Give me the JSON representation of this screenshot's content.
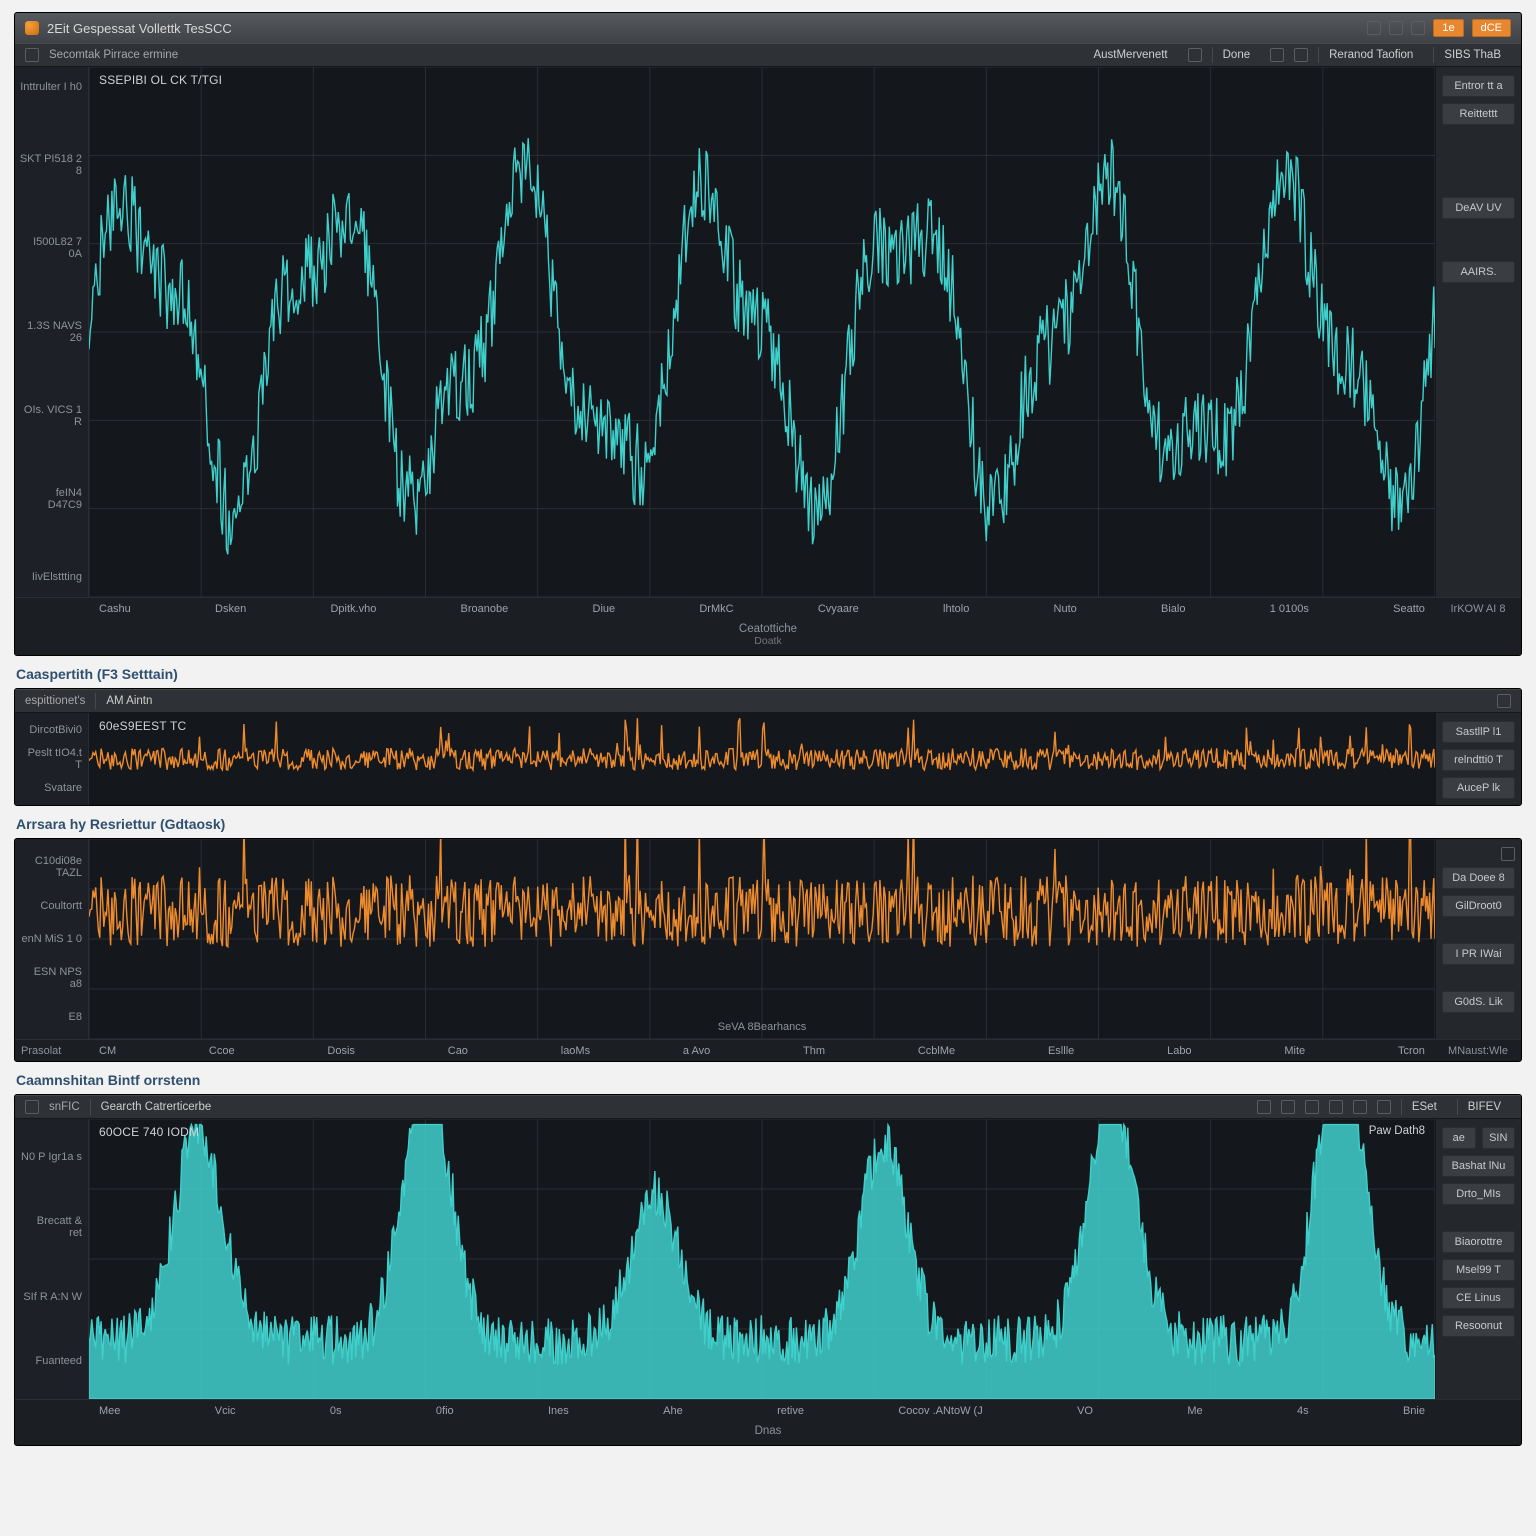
{
  "colors": {
    "teal": "#3fd0cc",
    "orange": "#ee8b2d"
  },
  "panelA": {
    "titlebar": {
      "title": "2Eit Gespessat Vollettk TesSCC",
      "right_icons": [
        "toggle-icon",
        "chart-icon",
        "play-icon"
      ],
      "accent1": "1e",
      "accent2": "dCE"
    },
    "subbar_left_icon": "list-icon",
    "subbar_title": "Secomtak Pirrace ermine",
    "subbar_tabs": [
      "AustMervenett",
      "Done",
      "Reranod  Taofion",
      "SIBS ThaB"
    ],
    "inner_title": "SSEPIBI OL CK  T/TGI",
    "y_ticks": [
      "Inttrulter I h0",
      "SKT PI518 2 8",
      "I500L82 7 0A",
      "1.3S NAVS 26",
      "OIs. VICS 1 R",
      "feIN4 D47C9",
      "IivElsttting"
    ],
    "x_ticks": [
      "Cashu",
      "Dsken",
      "Dpitk.vho",
      "Broanobe",
      "Diue",
      "DrMkC",
      "Cvyaare",
      "lhtolo",
      "Nuto",
      "Bialo",
      "1 0100s",
      "Seatto"
    ],
    "x_left_gutter": "",
    "x_right_gutter": "IrKOW AI 8",
    "xtitle": "Ceatottiche",
    "xsub": "Doatk",
    "right_buttons": [
      "Entror tt a",
      "Reittettt",
      "DeAV UV",
      "AAIRS."
    ]
  },
  "sectionB_title": "Caaspertith (F3 Setttain)",
  "panelB": {
    "subbar_left": "espittionet's",
    "subbar_title": "AM Aintn",
    "subbar_right_icon": "chevron-down-icon",
    "inner_title": "60eS9EEST TC",
    "y_ticks": [
      "DircotBivi0",
      "Peslt tIO4.t T",
      "Svatare"
    ],
    "right_buttons": [
      "SastllP l1",
      "relndtti0 T",
      "AuceP lk"
    ]
  },
  "sectionC_title": "Arrsara hy Resriettur (Gdtaosk)",
  "panelC": {
    "y_ticks": [
      "C10di08e TAZL",
      "Coultortt",
      "enN MiS 1 0",
      "ESN NPS a8",
      "E8"
    ],
    "x_ticks": [
      "CM",
      "Ccoe",
      "Dosis",
      "Cao",
      "laoMs",
      "a Avo",
      "Thm",
      "CcblMe",
      "Esllle",
      "Labo",
      "Mite",
      "Tcron"
    ],
    "x_left_gutter": "Prasolat",
    "x_right_gutter": "MNaust:Wle",
    "xtitle": "SeVA 8Bearhancs",
    "right_buttons": [
      "Da Doee 8",
      "GilDroot0",
      "I PR  IWai",
      "G0dS. Lik"
    ]
  },
  "sectionD_title": "Caamnshitan Bintf orrstenn",
  "panelD": {
    "subbar_left_icon": "menu-icon",
    "subbar_left_label": "snFIC",
    "subbar_title": "Gearcth Catrerticerbe",
    "subbar_right_icons": [
      "box-icon",
      "bars-icon",
      "grid-icon",
      "cog-icon",
      "eye-icon",
      "split-icon",
      "full-icon",
      "export-icon"
    ],
    "subbar_right_labels": [
      "ESet",
      "BIFEV"
    ],
    "inner_title": "60OCE 740 IODM",
    "inner_right": "Paw Dath8",
    "y_ticks": [
      "N0 P Igr1a s",
      "Brecatt & ret",
      "SIf R A:N W",
      "Fuanteed"
    ],
    "x_ticks": [
      "Mee",
      "Vcic",
      "0s",
      "0fio",
      "Ines",
      "Ahe",
      "retive",
      "Cocov .ANtoW (J",
      "VO",
      "Me",
      "4s",
      "Bnie"
    ],
    "xtitle": "Dnas",
    "right_buttons_top": [
      "ae",
      "SIN"
    ],
    "right_buttons": [
      "Bashat lNu",
      "Drto_MIs",
      "Biaorottre",
      "Msel99 T",
      "CE Linus",
      "Resoonut"
    ]
  },
  "chart_data": [
    {
      "id": "panelA",
      "type": "line",
      "title": "SSEPIBI OL CK  T/TGI",
      "series_name": "teal-noisy-wave",
      "xlim": [
        0,
        1000
      ],
      "ylim": [
        0,
        100
      ],
      "samples": 1000,
      "base_cycles": 7,
      "base_amplitude": 25,
      "baseline": 48,
      "noise_amplitude": 8
    },
    {
      "id": "panelB",
      "type": "line",
      "title": "60eS9EEST TC",
      "series_name": "orange-dense-low",
      "xlim": [
        0,
        1000
      ],
      "ylim": [
        0,
        100
      ],
      "samples": 1000,
      "baseline": 50,
      "noise_amplitude": 12,
      "spike_count": 40
    },
    {
      "id": "panelC",
      "type": "line",
      "title": "SeVA 8Bearhancs",
      "series_name": "orange-medium-noise",
      "xlim": [
        0,
        1000
      ],
      "ylim": [
        0,
        100
      ],
      "samples": 1000,
      "baseline": 64,
      "noise_amplitude": 18,
      "spike_count": 20
    },
    {
      "id": "panelD",
      "type": "area",
      "title": "60OCE 740 IODM",
      "series_name": "teal-peaks",
      "xlim": [
        0,
        1000
      ],
      "ylim": [
        0,
        100
      ],
      "samples": 1000,
      "peak_count": 6,
      "peak_height": 85,
      "noise_floor": 12
    }
  ]
}
